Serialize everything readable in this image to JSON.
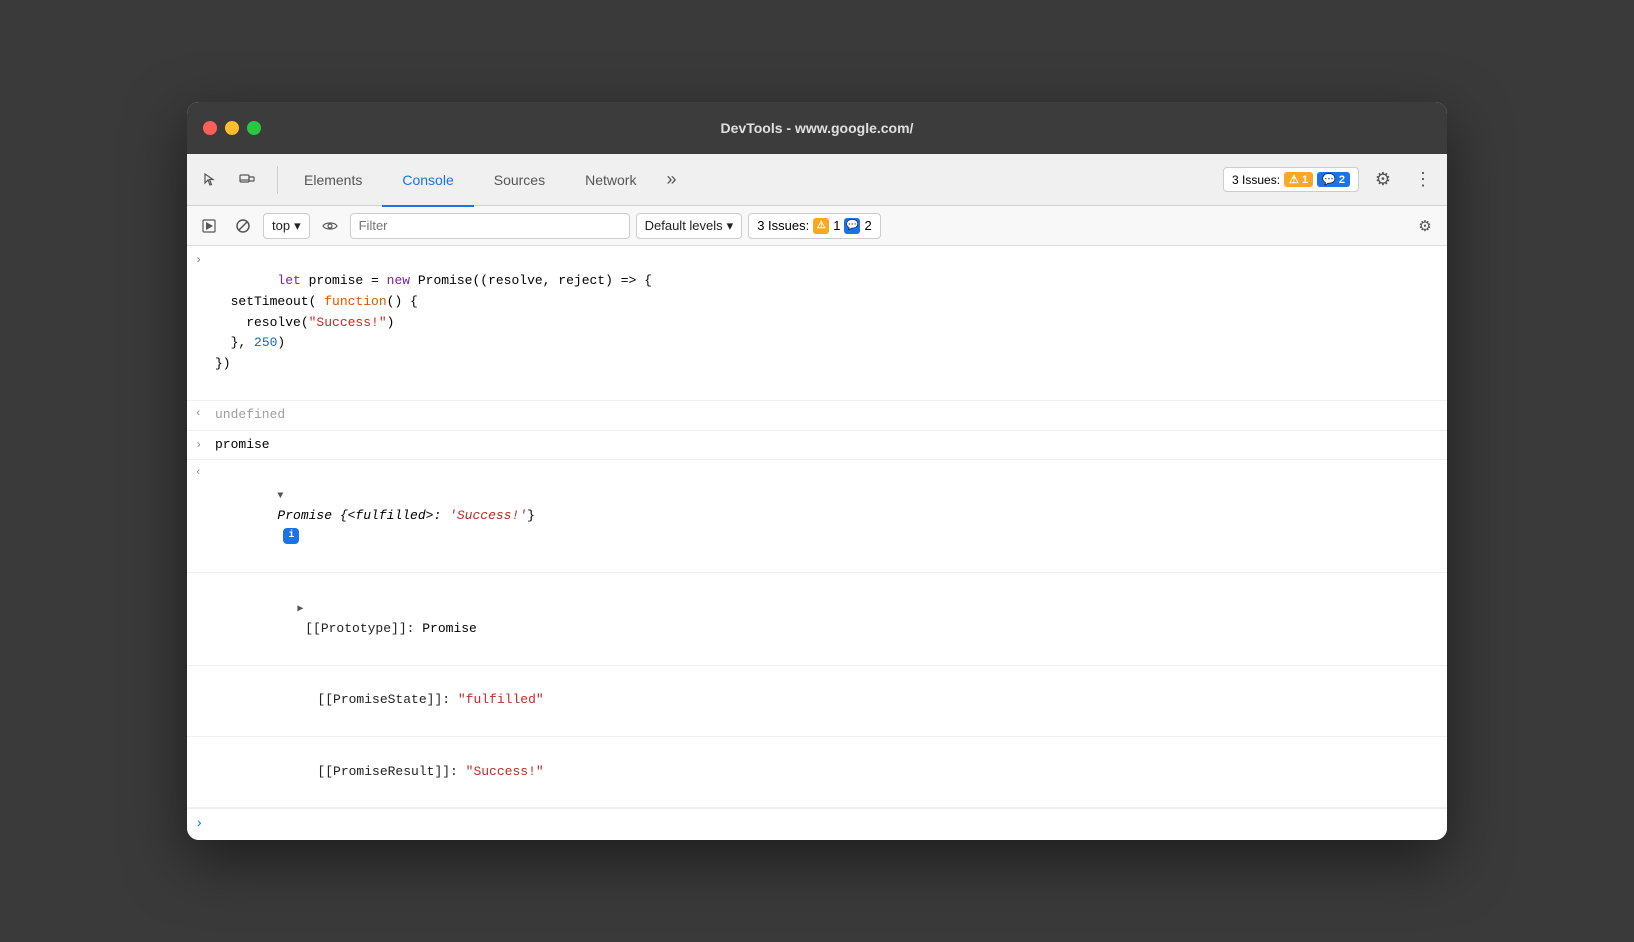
{
  "window": {
    "title": "DevTools - www.google.com/"
  },
  "toolbar": {
    "tabs": [
      {
        "label": "Elements",
        "active": false
      },
      {
        "label": "Console",
        "active": true
      },
      {
        "label": "Sources",
        "active": false
      },
      {
        "label": "Network",
        "active": false
      }
    ],
    "more_label": "»",
    "issues_label": "3 Issues:",
    "warn_count": "1",
    "info_count": "2"
  },
  "console_toolbar": {
    "top_selector": "top",
    "filter_placeholder": "Filter",
    "levels_label": "Default levels"
  },
  "code": {
    "line1_before": "let promise = ",
    "line1_new": "new",
    "line1_after": " Promise((resolve, reject) => {",
    "line2": "  setTimeout( ",
    "line2_fn": "function",
    "line2_after": "() {",
    "line3_before": "    resolve(",
    "line3_str": "\"Success!\"",
    "line3_after": ")",
    "line4_before": "  }, ",
    "line4_num": "250",
    "line4_after": ")",
    "line5": "})",
    "undefined_label": "undefined",
    "promise_label": "promise",
    "promise_obj": "Promise {<fulfilled>: ",
    "promise_fulfilled_val": "'Success!'",
    "promise_obj_close": "}",
    "prototype_label": "[[Prototype]]",
    "prototype_val": "Promise",
    "state_label": "[[PromiseState]]",
    "state_val": "\"fulfilled\"",
    "result_label": "[[PromiseResult]]",
    "result_val": "\"Success!\""
  }
}
